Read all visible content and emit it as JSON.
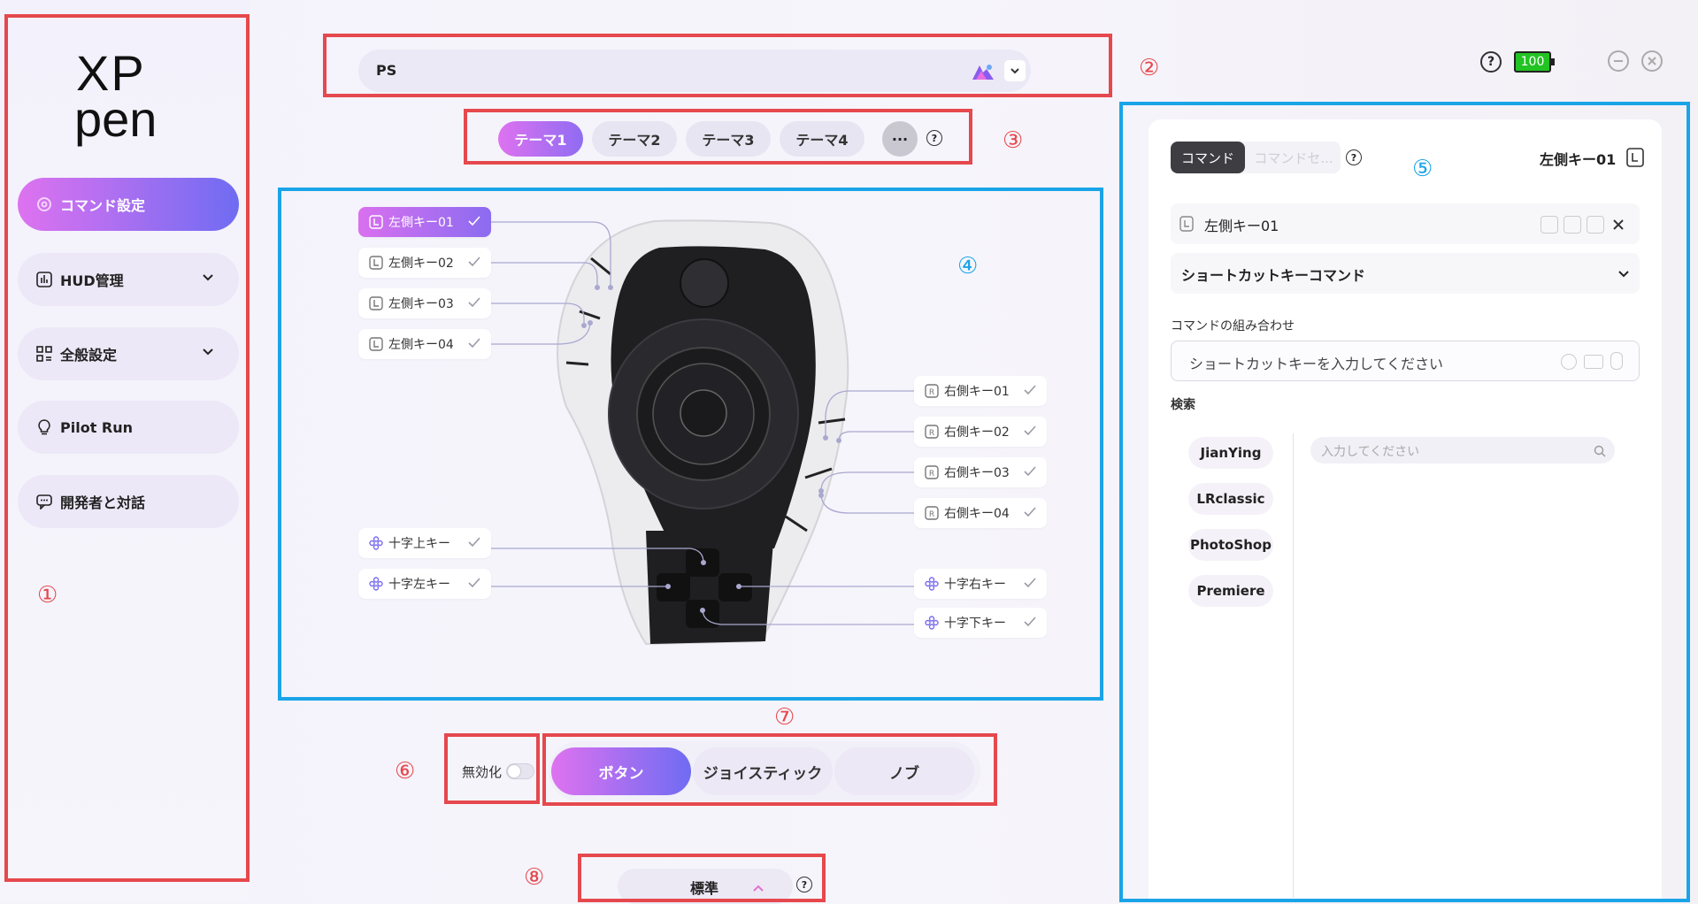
{
  "sidebar": {
    "logo": {
      "line1": "XP",
      "line2": "pen"
    },
    "items": [
      {
        "label": "コマンド設定"
      },
      {
        "label": "HUD管理"
      },
      {
        "label": "全般設定"
      },
      {
        "label": "Pilot Run"
      },
      {
        "label": "開発者と対話"
      }
    ]
  },
  "header": {
    "app_name": "PS",
    "battery": "100",
    "help": "?"
  },
  "themes": {
    "items": [
      "テーマ1",
      "テーマ2",
      "テーマ3",
      "テーマ4"
    ],
    "more": "···"
  },
  "device": {
    "left_keys": [
      "左側キー01",
      "左側キー02",
      "左側キー03",
      "左側キー04"
    ],
    "right_keys": [
      "右側キー01",
      "右側キー02",
      "右側キー03",
      "右側キー04"
    ],
    "cross_left_col": [
      "十字上キー",
      "十字左キー"
    ],
    "cross_right_col": [
      "十字右キー",
      "十字下キー"
    ]
  },
  "controls": {
    "disable_label": "無効化",
    "modes": [
      "ボタン",
      "ジョイスティック",
      "ノブ"
    ]
  },
  "footer": {
    "preset": "標準"
  },
  "panel": {
    "tabs": [
      "コマンド",
      "コマンドセ..."
    ],
    "current_key": "左側キー01",
    "selected_key": "左側キー01",
    "command_type": "ショートカットキーコマンド",
    "combo_label": "コマンドの組み合わせ",
    "combo_placeholder": "ショートカットキーを入力してください",
    "search_label": "検索",
    "search_placeholder": "入力してください",
    "apps": [
      "JianYing",
      "LRclassic",
      "PhotoShop",
      "Premiere"
    ]
  },
  "annotations": [
    "①",
    "②",
    "③",
    "④",
    "⑤",
    "⑥",
    "⑦",
    "⑧"
  ],
  "colors": {
    "accent_start": "#de72f0",
    "accent_end": "#6f6cf2",
    "annotation_red": "#e5484d",
    "annotation_blue": "#1aa4e8",
    "battery_green": "#22c322"
  }
}
